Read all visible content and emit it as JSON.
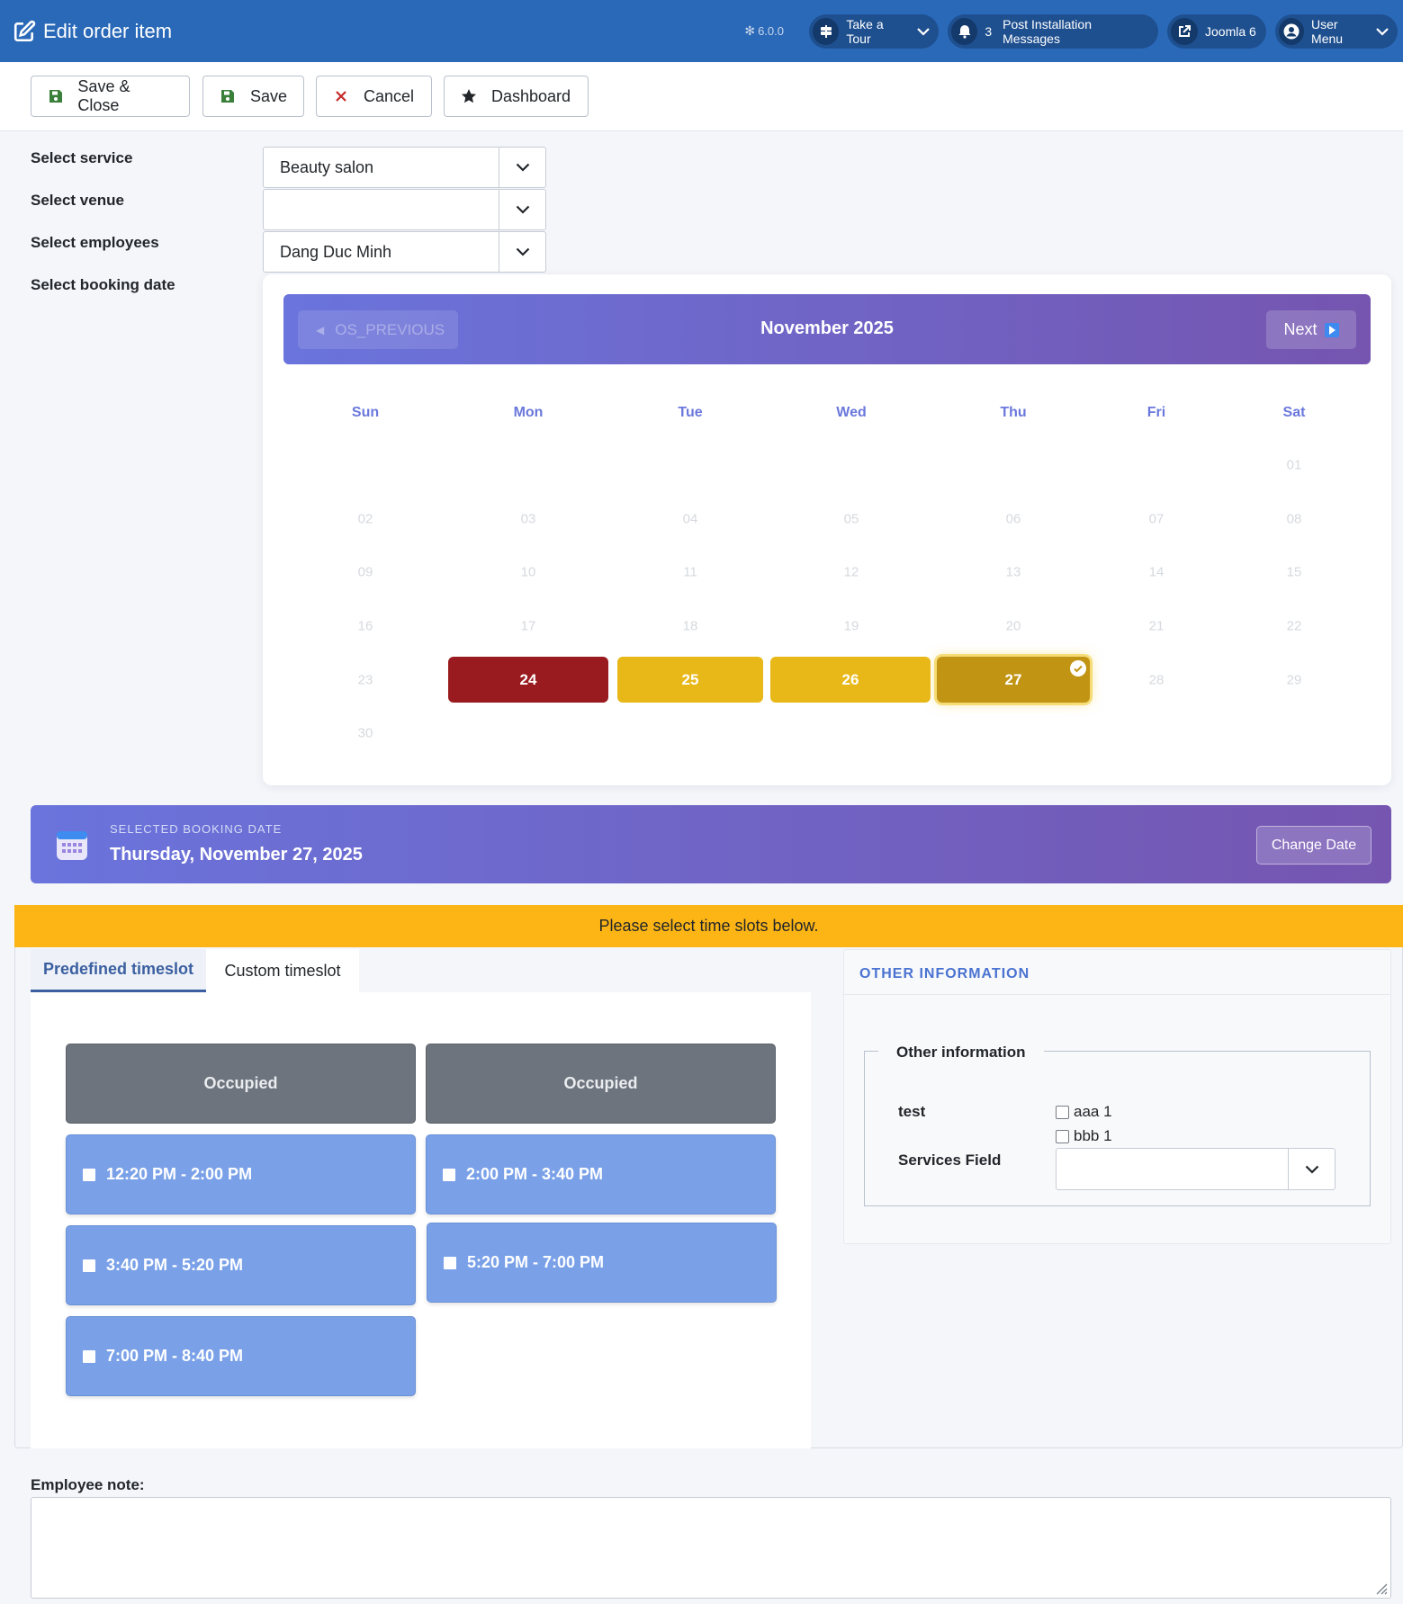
{
  "header": {
    "title": "Edit order item",
    "version": "6.0.0",
    "take_tour": "Take a Tour",
    "notif_count": "3",
    "post_install": "Post Installation Messages",
    "joomla": "Joomla 6",
    "user_menu": "User Menu"
  },
  "toolbar": {
    "save_close": "Save & Close",
    "save": "Save",
    "cancel": "Cancel",
    "dashboard": "Dashboard"
  },
  "form": {
    "service_label": "Select service",
    "service_value": "Beauty salon",
    "venue_label": "Select venue",
    "venue_value": "",
    "employees_label": "Select employees",
    "employees_value": "Dang Duc Minh",
    "date_label": "Select booking date"
  },
  "calendar": {
    "prev_label": "OS_PREVIOUS",
    "month": "November 2025",
    "next_label": "Next",
    "weekdays": [
      "Sun",
      "Mon",
      "Tue",
      "Wed",
      "Thu",
      "Fri",
      "Sat"
    ],
    "days": {
      "d01": "01",
      "d02": "02",
      "d03": "03",
      "d04": "04",
      "d05": "05",
      "d06": "06",
      "d07": "07",
      "d08": "08",
      "d09": "09",
      "d10": "10",
      "d11": "11",
      "d12": "12",
      "d13": "13",
      "d14": "14",
      "d15": "15",
      "d16": "16",
      "d17": "17",
      "d18": "18",
      "d19": "19",
      "d20": "20",
      "d21": "21",
      "d22": "22",
      "d23": "23",
      "d24": "24",
      "d25": "25",
      "d26": "26",
      "d27": "27",
      "d28": "28",
      "d29": "29",
      "d30": "30"
    },
    "colors": {
      "booked": "#9a1b1f",
      "partial": "#e8b819",
      "selected": "#c29413"
    }
  },
  "selected": {
    "caption": "SELECTED BOOKING DATE",
    "date": "Thursday, November 27, 2025",
    "change_label": "Change Date"
  },
  "notice": "Please select time slots below.",
  "tabs": {
    "predefined": "Predefined timeslot",
    "custom": "Custom timeslot"
  },
  "slots": {
    "occupied_1": "Occupied",
    "occupied_2": "Occupied",
    "s1": "12:20 PM - 2:00 PM",
    "s2": "2:00 PM - 3:40 PM",
    "s3": "3:40 PM - 5:20 PM",
    "s4": "5:20 PM - 7:00 PM",
    "s5": "7:00 PM - 8:40 PM"
  },
  "other_info": {
    "heading": "OTHER INFORMATION",
    "legend": "Other information",
    "test_label": "test",
    "opt1": "aaa 1",
    "opt2": "bbb 1",
    "services_label": "Services Field",
    "services_value": ""
  },
  "note": {
    "label": "Employee note:",
    "value": ""
  }
}
